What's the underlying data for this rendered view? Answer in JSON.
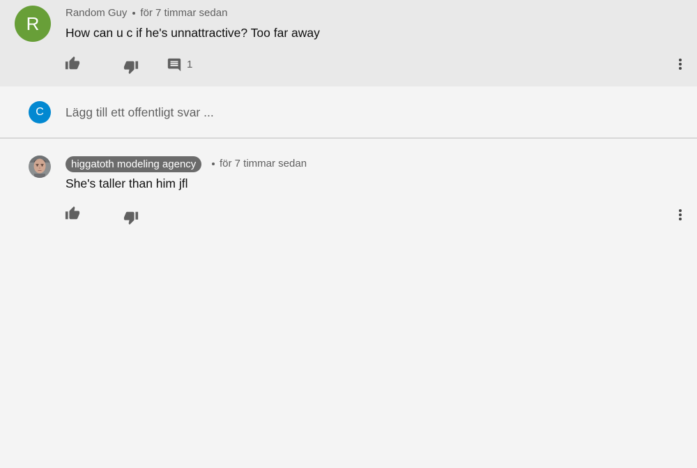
{
  "comment1": {
    "avatar_letter": "R",
    "avatar_color": "#689f38",
    "author": "Random Guy",
    "time": "för 7 timmar sedan",
    "text": "How can u c if he's unnattractive? Too far away",
    "reply_count": "1",
    "icons": [
      "thumb-up-icon",
      "thumb-down-icon",
      "comment-icon",
      "more-vertical-icon"
    ]
  },
  "reply_box": {
    "avatar_letter": "C",
    "avatar_color": "#0288d1",
    "placeholder": "Lägg till ett offentligt svar ..."
  },
  "comment2": {
    "author": "higgatoth modeling agency",
    "time": "för 7 timmar sedan",
    "text": "She's taller than him jfl",
    "icons": [
      "thumb-up-icon",
      "thumb-down-icon",
      "more-vertical-icon"
    ]
  },
  "colors": {
    "background": "#f4f4f4",
    "highlight": "#e9e9e9",
    "badge": "#6b6b6b",
    "icon": "#606060"
  }
}
